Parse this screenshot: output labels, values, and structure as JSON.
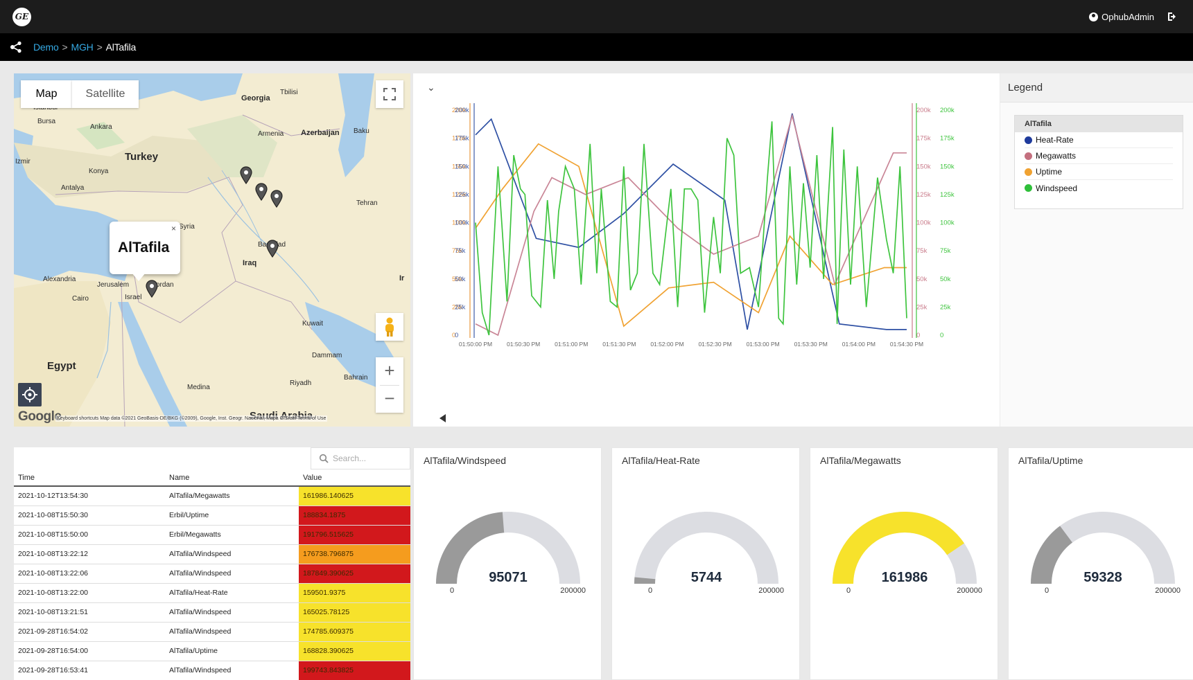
{
  "header": {
    "logo_text": "GE",
    "user_label": "OphubAdmin"
  },
  "breadcrumb": [
    "Demo",
    "MGH",
    "AlTafila"
  ],
  "map": {
    "tab_map": "Map",
    "tab_satellite": "Satellite",
    "popup_title": "AlTafila",
    "popup_close": "×",
    "attribution": "Keyboard shortcuts   Map data ©2021 GeoBasis-DE/BKG (©2009), Google, Inst. Geogr. Nacional, Mapa GISrael   Terms of Use",
    "google_logo": "Google",
    "places": [
      {
        "name": "Istanbul",
        "size": "sm"
      },
      {
        "name": "Bursa",
        "size": "sm"
      },
      {
        "name": "Ankara",
        "size": "sm"
      },
      {
        "name": "Turkey",
        "size": "lg"
      },
      {
        "name": "Izmir",
        "size": "sm"
      },
      {
        "name": "Konya",
        "size": "sm"
      },
      {
        "name": "Antalya",
        "size": "sm"
      },
      {
        "name": "Georgia",
        "size": "md"
      },
      {
        "name": "Tbilisi",
        "size": "sm"
      },
      {
        "name": "Armenia",
        "size": "sm"
      },
      {
        "name": "Azerbaijan",
        "size": "md"
      },
      {
        "name": "Baku",
        "size": "sm"
      },
      {
        "name": "Tehran",
        "size": "sm"
      },
      {
        "name": "Syria",
        "size": "sm"
      },
      {
        "name": "Baghdad",
        "size": "sm"
      },
      {
        "name": "Iraq",
        "size": "md"
      },
      {
        "name": "Ir",
        "size": "md"
      },
      {
        "name": "Alexandria",
        "size": "sm"
      },
      {
        "name": "Jerusalem",
        "size": "sm"
      },
      {
        "name": "Jordan",
        "size": "sm"
      },
      {
        "name": "Israel",
        "size": "sm"
      },
      {
        "name": "Cairo",
        "size": "sm"
      },
      {
        "name": "Kuwait",
        "size": "sm"
      },
      {
        "name": "Egypt",
        "size": "lg"
      },
      {
        "name": "Dammam",
        "size": "sm"
      },
      {
        "name": "Bahrain",
        "size": "sm"
      },
      {
        "name": "Medina",
        "size": "sm"
      },
      {
        "name": "Riyadh",
        "size": "sm"
      },
      {
        "name": "Saudi Arabia",
        "size": "lg"
      }
    ]
  },
  "chart_data": {
    "type": "line",
    "x": [
      "01:50:00 PM",
      "01:50:30 PM",
      "01:51:00 PM",
      "01:51:30 PM",
      "01:52:00 PM",
      "01:52:30 PM",
      "01:53:00 PM",
      "01:53:30 PM",
      "01:54:00 PM",
      "01:54:30 PM"
    ],
    "ylim": [
      0,
      200000
    ],
    "yticks": [
      "0",
      "25k",
      "50k",
      "75k",
      "100k",
      "125k",
      "150k",
      "175k",
      "200k"
    ],
    "axis_colors": [
      "#e8983c",
      "#3d5ba8",
      "#c97b8a",
      "#3ec43e"
    ],
    "series": [
      {
        "name": "Heat-Rate",
        "color": "#2d4fa3",
        "points": [
          [
            0,
            178000
          ],
          [
            0.35,
            192000
          ],
          [
            1.35,
            86000
          ],
          [
            2.3,
            78000
          ],
          [
            3.3,
            108000
          ],
          [
            4.4,
            152000
          ],
          [
            5.55,
            120000
          ],
          [
            6.05,
            5000
          ],
          [
            7.05,
            197000
          ],
          [
            8.1,
            10000
          ],
          [
            9.15,
            5000
          ],
          [
            9.6,
            5000
          ]
        ]
      },
      {
        "name": "Megawatts",
        "color": "#c98596",
        "points": [
          [
            0,
            10000
          ],
          [
            0.5,
            0
          ],
          [
            1.3,
            110000
          ],
          [
            1.7,
            140000
          ],
          [
            2.45,
            125000
          ],
          [
            3.4,
            140000
          ],
          [
            4.5,
            95000
          ],
          [
            5.3,
            72000
          ],
          [
            6.3,
            88000
          ],
          [
            7.05,
            195000
          ],
          [
            8.0,
            45000
          ],
          [
            9.3,
            162000
          ],
          [
            9.6,
            162000
          ]
        ]
      },
      {
        "name": "Uptime",
        "color": "#f0a232",
        "points": [
          [
            0,
            95000
          ],
          [
            0.6,
            130000
          ],
          [
            1.4,
            170000
          ],
          [
            2.3,
            150000
          ],
          [
            3.3,
            8000
          ],
          [
            4.3,
            42000
          ],
          [
            5.3,
            47000
          ],
          [
            6.3,
            20000
          ],
          [
            7.0,
            88000
          ],
          [
            7.95,
            45000
          ],
          [
            9.1,
            60000
          ],
          [
            9.6,
            60000
          ]
        ]
      },
      {
        "name": "Windspeed",
        "color": "#3ec43e",
        "points": [
          [
            0,
            100000
          ],
          [
            0.15,
            20000
          ],
          [
            0.3,
            0
          ],
          [
            0.5,
            150000
          ],
          [
            0.7,
            30000
          ],
          [
            0.85,
            160000
          ],
          [
            1.0,
            130000
          ],
          [
            1.1,
            125000
          ],
          [
            1.25,
            35000
          ],
          [
            1.45,
            25000
          ],
          [
            1.6,
            120000
          ],
          [
            1.75,
            50000
          ],
          [
            1.85,
            110000
          ],
          [
            2.0,
            150000
          ],
          [
            2.2,
            130000
          ],
          [
            2.35,
            45000
          ],
          [
            2.55,
            170000
          ],
          [
            2.7,
            55000
          ],
          [
            2.8,
            130000
          ],
          [
            3.0,
            30000
          ],
          [
            3.15,
            25000
          ],
          [
            3.3,
            150000
          ],
          [
            3.45,
            40000
          ],
          [
            3.6,
            55000
          ],
          [
            3.75,
            170000
          ],
          [
            3.95,
            55000
          ],
          [
            4.1,
            45000
          ],
          [
            4.35,
            130000
          ],
          [
            4.5,
            25000
          ],
          [
            4.65,
            130000
          ],
          [
            4.8,
            130000
          ],
          [
            4.95,
            120000
          ],
          [
            5.1,
            20000
          ],
          [
            5.3,
            105000
          ],
          [
            5.45,
            55000
          ],
          [
            5.6,
            175000
          ],
          [
            5.75,
            160000
          ],
          [
            5.9,
            55000
          ],
          [
            6.1,
            60000
          ],
          [
            6.3,
            25000
          ],
          [
            6.5,
            140000
          ],
          [
            6.6,
            190000
          ],
          [
            6.75,
            15000
          ],
          [
            6.85,
            10000
          ],
          [
            7.0,
            150000
          ],
          [
            7.15,
            45000
          ],
          [
            7.3,
            135000
          ],
          [
            7.45,
            60000
          ],
          [
            7.6,
            160000
          ],
          [
            7.75,
            50000
          ],
          [
            7.95,
            185000
          ],
          [
            8.05,
            10000
          ],
          [
            8.2,
            165000
          ],
          [
            8.35,
            45000
          ],
          [
            8.5,
            150000
          ],
          [
            8.7,
            25000
          ],
          [
            8.95,
            140000
          ],
          [
            9.15,
            85000
          ],
          [
            9.3,
            55000
          ],
          [
            9.45,
            150000
          ],
          [
            9.6,
            15000
          ]
        ]
      }
    ]
  },
  "legend": {
    "header": "Legend",
    "group": "AlTafila",
    "items": [
      {
        "name": "Heat-Rate",
        "color": "#1f3b9c"
      },
      {
        "name": "Megawatts",
        "color": "#c4707f"
      },
      {
        "name": "Uptime",
        "color": "#f0a232"
      },
      {
        "name": "Windspeed",
        "color": "#2fbf3a"
      }
    ]
  },
  "table": {
    "search_placeholder": "Search...",
    "columns": [
      "Time",
      "Name",
      "Value"
    ],
    "rows": [
      {
        "time": "2021-10-12T13:54:30",
        "name": "AlTafila/Megawatts",
        "value": "161986.140625",
        "color": "#f7e22b"
      },
      {
        "time": "2021-10-08T15:50:30",
        "name": "Erbil/Uptime",
        "value": "188834.1875",
        "color": "#d2181c"
      },
      {
        "time": "2021-10-08T15:50:00",
        "name": "Erbil/Megawatts",
        "value": "191796.515625",
        "color": "#d2181c"
      },
      {
        "time": "2021-10-08T13:22:12",
        "name": "AlTafila/Windspeed",
        "value": "176738.796875",
        "color": "#f59c1e"
      },
      {
        "time": "2021-10-08T13:22:06",
        "name": "AlTafila/Windspeed",
        "value": "187849.390625",
        "color": "#d2181c"
      },
      {
        "time": "2021-10-08T13:22:00",
        "name": "AlTafila/Heat-Rate",
        "value": "159501.9375",
        "color": "#f7e22b"
      },
      {
        "time": "2021-10-08T13:21:51",
        "name": "AlTafila/Windspeed",
        "value": "165025.78125",
        "color": "#f7e22b"
      },
      {
        "time": "2021-09-28T16:54:02",
        "name": "AlTafila/Windspeed",
        "value": "174785.609375",
        "color": "#f7e22b"
      },
      {
        "time": "2021-09-28T16:54:00",
        "name": "AlTafila/Uptime",
        "value": "168828.390625",
        "color": "#f7e22b"
      },
      {
        "time": "2021-09-28T16:53:41",
        "name": "AlTafila/Windspeed",
        "value": "199743.843825",
        "color": "#d2181c"
      }
    ]
  },
  "gauges": [
    {
      "title": "AlTafila/Windspeed",
      "value": 95071,
      "display": "95071",
      "min": "0",
      "max": "200000",
      "fraction": 0.475,
      "color": "#9a9a9a"
    },
    {
      "title": "AlTafila/Heat-Rate",
      "value": 5744,
      "display": "5744",
      "min": "0",
      "max": "200000",
      "fraction": 0.029,
      "color": "#9a9a9a"
    },
    {
      "title": "AlTafila/Megawatts",
      "value": 161986,
      "display": "161986",
      "min": "0",
      "max": "200000",
      "fraction": 0.81,
      "color": "#f7e22b"
    },
    {
      "title": "AlTafila/Uptime",
      "value": 59328,
      "display": "59328",
      "min": "0",
      "max": "200000",
      "fraction": 0.297,
      "color": "#9a9a9a"
    }
  ]
}
